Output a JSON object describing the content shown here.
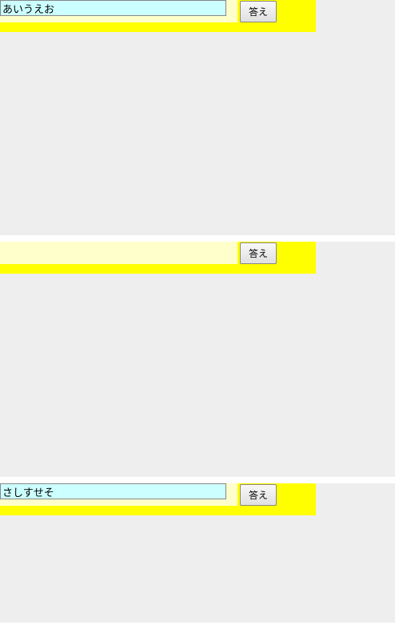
{
  "panels": [
    {
      "input_value": "あいうえお",
      "button_label": "答え",
      "has_input": true
    },
    {
      "input_value": "",
      "button_label": "答え",
      "has_input": false
    },
    {
      "input_value": "さしすせそ",
      "button_label": "答え",
      "has_input": true
    }
  ]
}
